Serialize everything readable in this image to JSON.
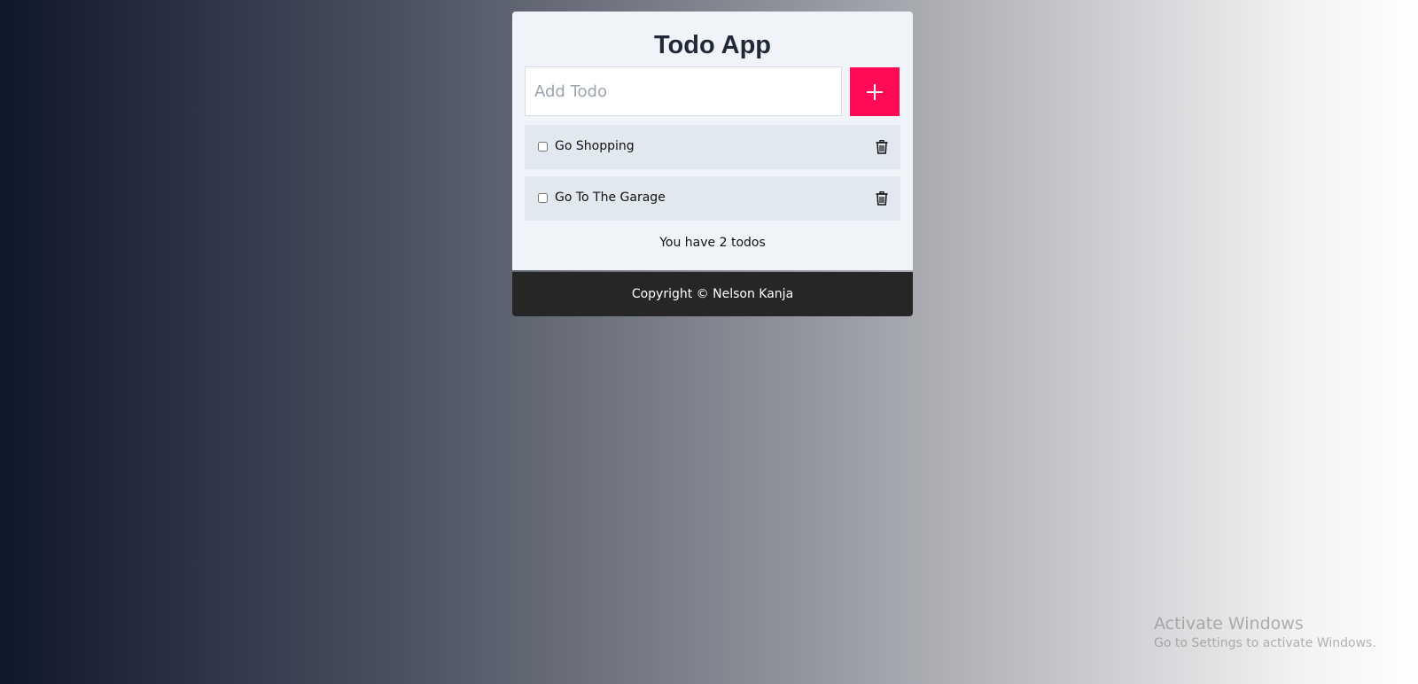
{
  "app": {
    "title": "Todo App"
  },
  "add_form": {
    "placeholder": "Add Todo",
    "add_icon": "plus-icon",
    "accent_color": "#ff0a54"
  },
  "todos": [
    {
      "label": "Go Shopping",
      "checked": false,
      "delete_icon": "trash-icon"
    },
    {
      "label": "Go To The Garage",
      "checked": false,
      "delete_icon": "trash-icon"
    }
  ],
  "summary": "You have 2 todos",
  "footer": {
    "text": "Copyright © Nelson Kanja"
  },
  "watermark": {
    "title": "Activate Windows",
    "subtitle": "Go to Settings to activate Windows."
  }
}
